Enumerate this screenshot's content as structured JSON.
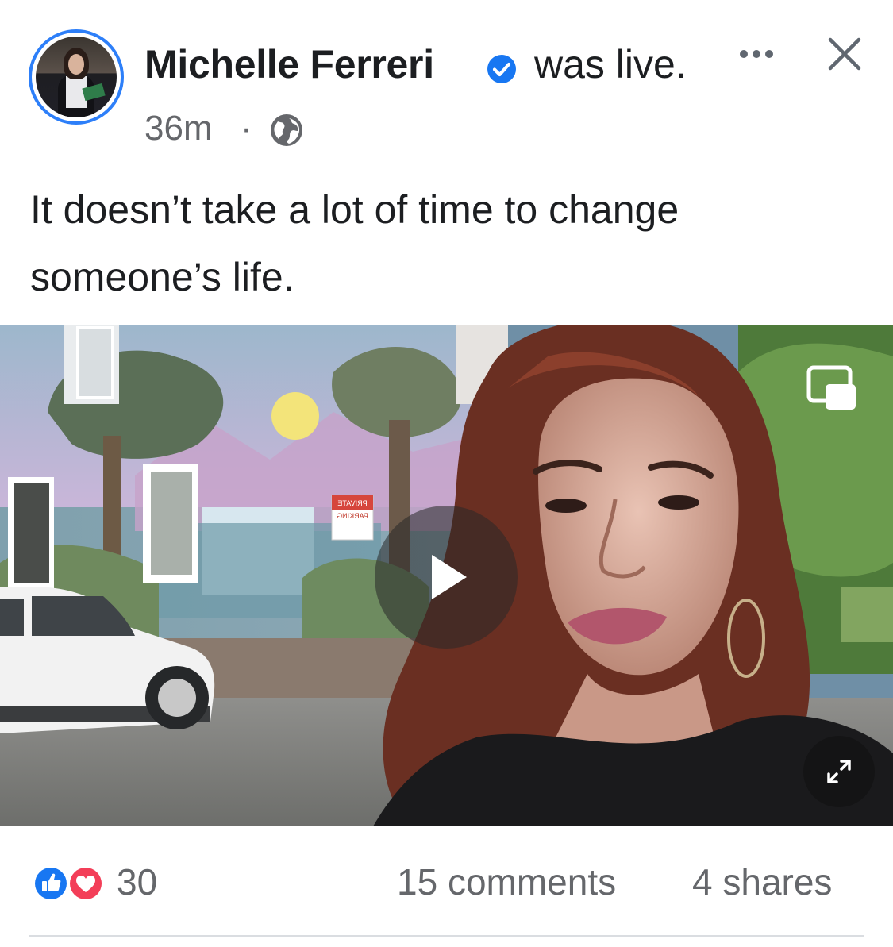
{
  "post": {
    "author": "Michelle Ferreri",
    "status": "was live.",
    "time": "36m",
    "separator": "·",
    "privacy_icon": "globe-icon",
    "verified_icon": "verified-badge-icon",
    "text": "It doesn’t take a lot of time to change someone’s life."
  },
  "video": {
    "sign_text_1": "PRIVATE",
    "sign_text_2": "PARKING"
  },
  "footer": {
    "reaction_count": "30",
    "comments": "15 comments",
    "shares": "4 shares"
  },
  "colors": {
    "accent": "#2d7ff9",
    "text_primary": "#1c1e21",
    "text_secondary": "#65676b",
    "like_blue": "#1877f2",
    "love_red": "#f33e58"
  }
}
